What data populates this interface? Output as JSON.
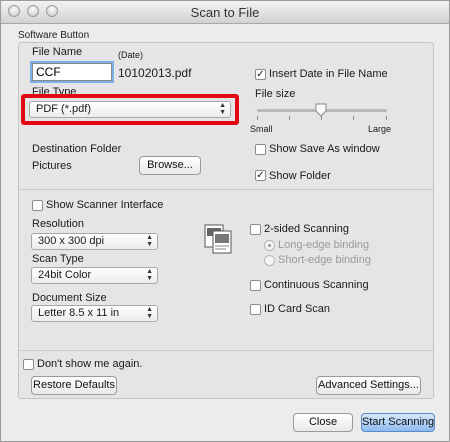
{
  "window": {
    "title": "Scan to File"
  },
  "group": {
    "title": "Software Button"
  },
  "file_name": {
    "label": "File Name",
    "date_label": "(Date)",
    "value": "CCF",
    "date_value": "10102013.pdf"
  },
  "file_type": {
    "label": "File Type",
    "selected": "PDF (*.pdf)"
  },
  "insert_date": {
    "label": "Insert Date in File Name",
    "checked": true
  },
  "file_size": {
    "label": "File size",
    "min_label": "Small",
    "max_label": "Large",
    "level": 0.5
  },
  "destination": {
    "label": "Destination Folder",
    "value": "Pictures",
    "browse_label": "Browse..."
  },
  "show_save_as": {
    "label": "Show Save As window",
    "checked": false
  },
  "show_folder": {
    "label": "Show Folder",
    "checked": true
  },
  "show_scanner": {
    "label": "Show Scanner Interface",
    "checked": false
  },
  "resolution": {
    "label": "Resolution",
    "selected": "300 x 300 dpi"
  },
  "scan_type": {
    "label": "Scan Type",
    "selected": "24bit Color"
  },
  "document_size": {
    "label": "Document Size",
    "selected": "Letter 8.5 x 11 in"
  },
  "two_sided": {
    "label": "2-sided Scanning",
    "checked": false,
    "long_edge": "Long-edge binding",
    "short_edge": "Short-edge binding"
  },
  "continuous": {
    "label": "Continuous Scanning",
    "checked": false
  },
  "id_card": {
    "label": "ID Card Scan",
    "checked": false
  },
  "dont_show": {
    "label": "Don't show me again.",
    "checked": false
  },
  "buttons": {
    "restore": "Restore Defaults",
    "advanced": "Advanced Settings...",
    "close": "Close",
    "start": "Start Scanning"
  },
  "icons": {
    "traffic": "window-control-icon",
    "scanner": "two-sided-scanning-icon"
  }
}
